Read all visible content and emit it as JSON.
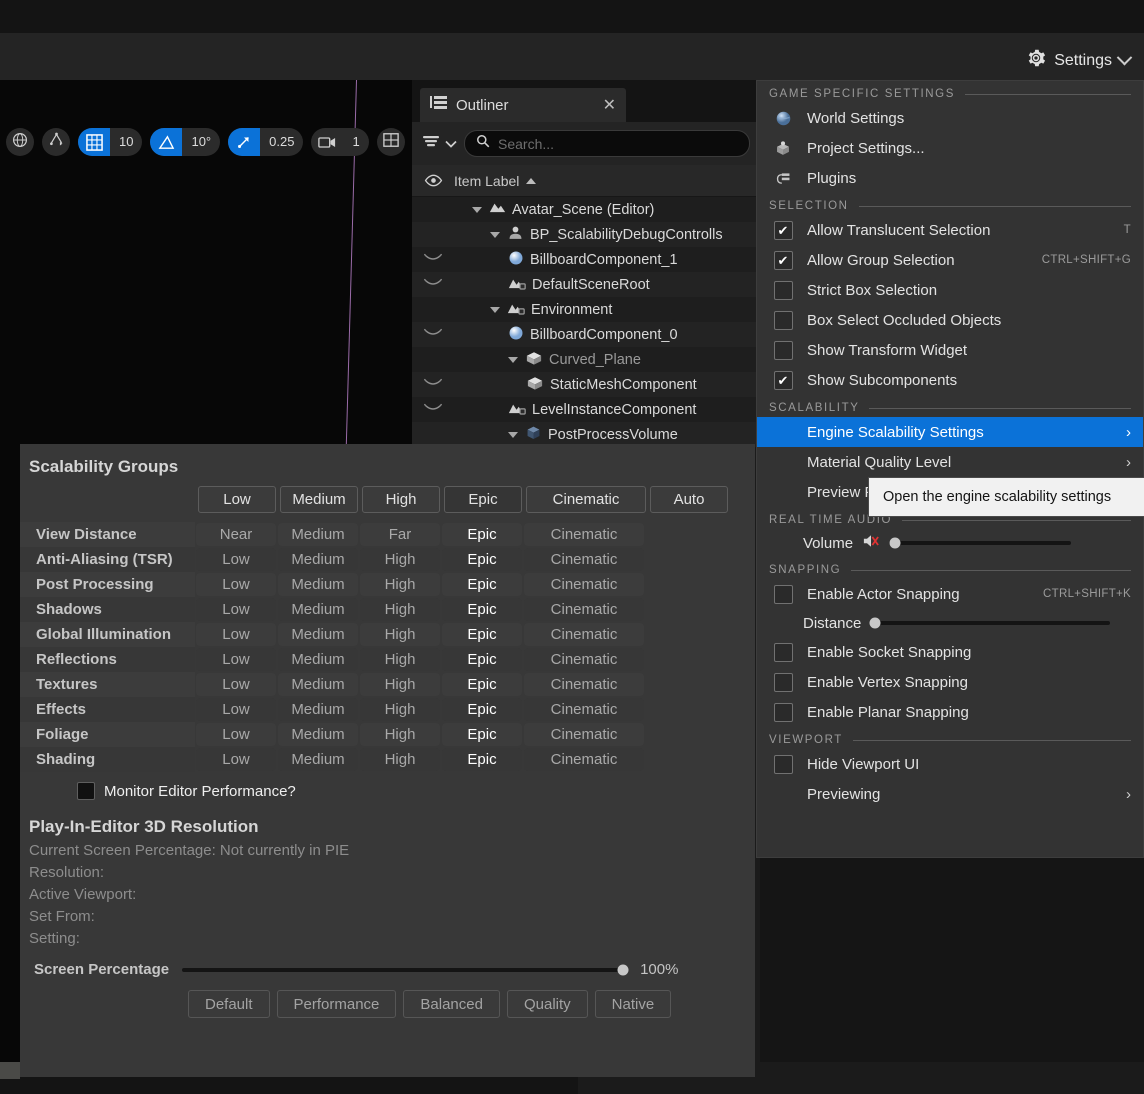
{
  "topbar": {
    "settings_label": "Settings",
    "gear_icon": "gear-icon",
    "chevron_icon": "chevron-down-icon"
  },
  "viewport": {
    "toolbar": [
      {
        "icon": "globe-coordinate-system-icon",
        "type": "round",
        "active": false
      },
      {
        "icon": "transform-snap-icon",
        "type": "round",
        "active": false
      },
      {
        "icon": "grid-snap-icon",
        "type": "pill",
        "value": "10",
        "active": true
      },
      {
        "icon": "angle-snap-icon",
        "type": "pill",
        "value": "10°",
        "active": true
      },
      {
        "icon": "scale-snap-icon",
        "type": "pill",
        "value": "0.25",
        "active": true
      },
      {
        "icon": "camera-speed-icon",
        "type": "pill",
        "value": "1",
        "active": false
      },
      {
        "icon": "viewport-layout-icon",
        "type": "round",
        "active": false
      }
    ]
  },
  "outliner": {
    "tab_title": "Outliner",
    "close_icon": "close-icon",
    "panel_icon": "outliner-icon",
    "filter_icon": "filter-icon",
    "filter_chevron_icon": "chevron-down-icon",
    "search_icon": "search-icon",
    "search_placeholder": "Search...",
    "search_value": "",
    "column_eye_icon": "eye-icon",
    "column_label": "Item Label",
    "sort_icon": "sort-ascending-icon",
    "rows": [
      {
        "label": "Avatar_Scene (Editor)",
        "indent": 1,
        "expander": true,
        "icon": "level-icon",
        "eye": false,
        "dim": false
      },
      {
        "label": "BP_ScalabilityDebugControlls",
        "indent": 2,
        "expander": true,
        "icon": "actor-icon",
        "eye": false,
        "dim": false
      },
      {
        "label": "BillboardComponent_1",
        "indent": 3,
        "expander": false,
        "icon": "billboard-icon",
        "eye": true,
        "dim": false
      },
      {
        "label": "DefaultSceneRoot",
        "indent": 3,
        "expander": false,
        "icon": "scene-component-icon",
        "eye": true,
        "dim": false
      },
      {
        "label": "Environment",
        "indent": 2,
        "expander": true,
        "icon": "scene-component-icon",
        "eye": false,
        "dim": false
      },
      {
        "label": "BillboardComponent_0",
        "indent": 3,
        "expander": false,
        "icon": "billboard-icon",
        "eye": true,
        "dim": false
      },
      {
        "label": "Curved_Plane",
        "indent": 3,
        "expander": true,
        "icon": "static-mesh-icon",
        "eye": false,
        "dim": true
      },
      {
        "label": "StaticMeshComponent",
        "indent": 4,
        "expander": false,
        "icon": "static-mesh-icon",
        "eye": true,
        "dim": false
      },
      {
        "label": "LevelInstanceComponent",
        "indent": 3,
        "expander": false,
        "icon": "scene-component-icon",
        "eye": true,
        "dim": false
      },
      {
        "label": "PostProcessVolume",
        "indent": 3,
        "expander": true,
        "icon": "volume-icon",
        "eye": false,
        "dim": false
      }
    ]
  },
  "settings_menu": {
    "sections": [
      {
        "title": "GAME SPECIFIC SETTINGS",
        "items": [
          {
            "type": "icon",
            "label": "World Settings",
            "icon": "world-settings-icon"
          },
          {
            "type": "icon",
            "label": "Project Settings...",
            "icon": "project-settings-icon"
          },
          {
            "type": "icon",
            "label": "Plugins",
            "icon": "plugins-icon"
          }
        ]
      },
      {
        "title": "SELECTION",
        "items": [
          {
            "type": "checkbox",
            "label": "Allow Translucent Selection",
            "checked": true,
            "shortcut": "T"
          },
          {
            "type": "checkbox",
            "label": "Allow Group Selection",
            "checked": true,
            "shortcut": "CTRL+SHIFT+G"
          },
          {
            "type": "checkbox",
            "label": "Strict Box Selection",
            "checked": false,
            "shortcut": ""
          },
          {
            "type": "checkbox",
            "label": "Box Select Occluded Objects",
            "checked": false,
            "shortcut": ""
          },
          {
            "type": "checkbox",
            "label": "Show Transform Widget",
            "checked": false,
            "shortcut": ""
          },
          {
            "type": "checkbox",
            "label": "Show Subcomponents",
            "checked": true,
            "shortcut": ""
          }
        ]
      },
      {
        "title": "SCALABILITY",
        "items": [
          {
            "type": "submenu",
            "label": "Engine Scalability Settings",
            "highlighted": true,
            "arrow": "›"
          },
          {
            "type": "submenu",
            "label": "Material Quality Level",
            "highlighted": false,
            "arrow": "›"
          },
          {
            "type": "submenu",
            "label": "Preview Platform",
            "highlighted": false,
            "arrow": "›"
          }
        ]
      },
      {
        "title": "REAL TIME AUDIO",
        "items": [
          {
            "type": "slider",
            "label": "Volume",
            "icon": "volume-muted-icon",
            "fill": 3
          }
        ]
      },
      {
        "title": "SNAPPING",
        "items": [
          {
            "type": "checkbox",
            "label": "Enable Actor Snapping",
            "checked": false,
            "shortcut": "CTRL+SHIFT+K"
          },
          {
            "type": "slider",
            "label": "Distance",
            "icon": "",
            "fill": 2
          },
          {
            "type": "checkbox",
            "label": "Enable Socket Snapping",
            "checked": false,
            "shortcut": ""
          },
          {
            "type": "checkbox",
            "label": "Enable Vertex Snapping",
            "checked": false,
            "shortcut": ""
          },
          {
            "type": "checkbox",
            "label": "Enable Planar Snapping",
            "checked": false,
            "shortcut": ""
          }
        ]
      },
      {
        "title": "VIEWPORT",
        "items": [
          {
            "type": "checkbox",
            "label": "Hide Viewport UI",
            "checked": false,
            "shortcut": ""
          },
          {
            "type": "submenu",
            "label": "Previewing",
            "highlighted": false,
            "arrow": "›"
          }
        ]
      }
    ]
  },
  "tooltip": {
    "text": "Open the engine scalability settings"
  },
  "scalability_panel": {
    "title": "Scalability Groups",
    "level_buttons": [
      "Low",
      "Medium",
      "High",
      "Epic",
      "Cinematic",
      "Auto"
    ],
    "selected_level": "Epic",
    "columns": [
      "Low",
      "Medium",
      "High",
      "Epic",
      "Cinematic"
    ],
    "selected_column_index": 3,
    "rows": [
      {
        "name": "View Distance",
        "values": [
          "Near",
          "Medium",
          "Far",
          "Epic",
          "Cinematic"
        ]
      },
      {
        "name": "Anti-Aliasing (TSR)",
        "values": [
          "Low",
          "Medium",
          "High",
          "Epic",
          "Cinematic"
        ]
      },
      {
        "name": "Post Processing",
        "values": [
          "Low",
          "Medium",
          "High",
          "Epic",
          "Cinematic"
        ]
      },
      {
        "name": "Shadows",
        "values": [
          "Low",
          "Medium",
          "High",
          "Epic",
          "Cinematic"
        ]
      },
      {
        "name": "Global Illumination",
        "values": [
          "Low",
          "Medium",
          "High",
          "Epic",
          "Cinematic"
        ]
      },
      {
        "name": "Reflections",
        "values": [
          "Low",
          "Medium",
          "High",
          "Epic",
          "Cinematic"
        ]
      },
      {
        "name": "Textures",
        "values": [
          "Low",
          "Medium",
          "High",
          "Epic",
          "Cinematic"
        ]
      },
      {
        "name": "Effects",
        "values": [
          "Low",
          "Medium",
          "High",
          "Epic",
          "Cinematic"
        ]
      },
      {
        "name": "Foliage",
        "values": [
          "Low",
          "Medium",
          "High",
          "Epic",
          "Cinematic"
        ]
      },
      {
        "name": "Shading",
        "values": [
          "Low",
          "Medium",
          "High",
          "Epic",
          "Cinematic"
        ]
      }
    ],
    "monitor_label": "Monitor Editor Performance?",
    "monitor_checked": false,
    "pie_title": "Play-In-Editor 3D Resolution",
    "pie_lines": [
      "Current Screen Percentage: Not currently in PIE",
      "Resolution:",
      "Active Viewport:",
      "Set From:",
      "Setting:"
    ],
    "screen_percentage_label": "Screen Percentage",
    "screen_percentage_value": "100%",
    "screen_percentage_fill": 99,
    "preset_buttons": [
      "Default",
      "Performance",
      "Balanced",
      "Quality",
      "Native"
    ]
  },
  "colors": {
    "accent_blue": "#0b7ae8",
    "menu_bg": "#333333",
    "panel_bg": "#383838",
    "tooltip_bg": "#f1f1f1"
  }
}
